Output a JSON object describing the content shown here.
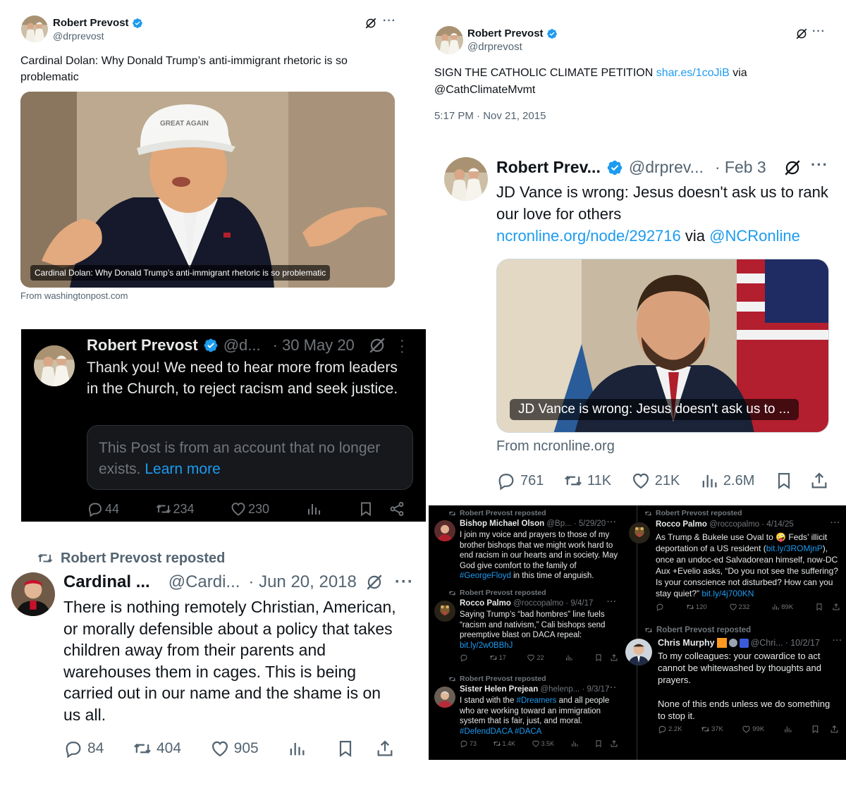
{
  "colors": {
    "link": "#1d9bf0",
    "verified": "#1d9bf0",
    "muted": "#536471",
    "dark_muted": "#71767b"
  },
  "icons": [
    "verified-badge-icon",
    "grok-icon",
    "more-icon",
    "reply-icon",
    "repost-icon",
    "like-icon",
    "views-icon",
    "bookmark-icon",
    "share-icon"
  ],
  "p1": {
    "name": "Robert Prevost",
    "handle": "@drprevost",
    "text": "Cardinal Dolan: Why Donald Trump’s anti-immigrant rhetoric is so problematic",
    "card_caption": "Cardinal Dolan: Why Donald Trump’s anti-immigrant rhetoric is so problematic",
    "card_source": "From washingtonpost.com",
    "hat_text": "GREAT AGAIN"
  },
  "p2": {
    "name": "Robert Prevost",
    "handle": "@drprevost",
    "text": "SIGN THE CATHOLIC CLIMATE PETITION ",
    "link": "shar.es/1coJiB",
    "text_tail": " via",
    "line2": "@CathClimateMvmt",
    "timestamp": "5:17 PM · Nov 21, 2015"
  },
  "p3": {
    "name": "Robert Prev...",
    "handle": "@drprev...",
    "date": "· Feb 3",
    "text": "JD Vance is wrong: Jesus doesn't ask us to rank our love for others",
    "link": "ncronline.org/node/292716",
    "via": " via ",
    "mention": "@NCRonline",
    "card_caption": "JD Vance is wrong: Jesus doesn't ask us to ...",
    "card_source": "From ncronline.org",
    "stats": {
      "replies": "761",
      "reposts": "11K",
      "likes": "21K",
      "views": "2.6M"
    }
  },
  "p4": {
    "name": "Robert Prevost",
    "handle": "@d...",
    "date": "· 30 May 20",
    "text": "Thank you! We need to hear more from leaders in the Church, to reject racism and seek justice.",
    "notice": "This Post is from an account that no longer exists. ",
    "notice_link": "Learn more",
    "stats": {
      "replies": "44",
      "reposts": "234",
      "likes": "230"
    }
  },
  "p5": {
    "repost_label": "Robert Prevost reposted",
    "name": "Cardinal ...",
    "handle": "@Cardi...",
    "date": "· Jun 20, 2018",
    "text": "There is nothing remotely Christian, American, or morally defensible about a policy that takes children away from their parents and warehouses them in cages. This is being carried out in our name and the shame is on us all.",
    "stats": {
      "replies": "84",
      "reposts": "404",
      "likes": "905"
    }
  },
  "g": {
    "olson": {
      "repost_label": "Robert Prevost reposted",
      "name": "Bishop Michael Olson",
      "handle": "@Bp...",
      "date": "· 5/29/20",
      "text": "I join my voice and prayers to those of my brother bishops that we might work hard to end racism in our hearts and in society. May God give comfort to the family of ",
      "hashtag": "#GeorgeFloyd",
      "tail": " in this time of anguish."
    },
    "palmo1": {
      "repost_label": "Robert Prevost reposted",
      "name": "Rocco Palmo",
      "handle": "@roccopalmo",
      "date": "· 9/4/17",
      "text": "Saying Trump’s “bad hombres” line fuels “racism and nativism,” Cali bishops send preemptive blast on DACA repeal: ",
      "link": "bit.ly/2w0BBhJ",
      "stats": {
        "reposts": "17",
        "likes": "22"
      }
    },
    "prejean": {
      "repost_label": "Robert Prevost reposted",
      "name": "Sister Helen Prejean",
      "handle": "@helenp...",
      "date": "· 9/3/17",
      "text1": "I stand with the ",
      "hashtag1": "#Dreamers",
      "text2": " and all people who are working toward an immigration system that is fair, just, and moral. ",
      "hashtag2": "#DefendDACA",
      "hashtag3": "#DACA",
      "stats": {
        "replies": "73",
        "reposts": "1.4K",
        "likes": "3.5K"
      }
    },
    "palmo2": {
      "repost_label": "Robert Prevost reposted",
      "name": "Rocco Palmo",
      "handle": "@roccopalmo",
      "date": "· 4/14/25",
      "text1": "As Trump & Bukele use Oval to ",
      "emoji": "🤪",
      "text2": " Feds’ illicit deportation of a US resident (",
      "link1": "bit.ly/3ROMjnP",
      "text3": "), once an undoc-ed Salvadorean himself, now-DC Aux +Evelio asks, “Do you not see the suffering? Is your conscience not disturbed? How can you stay quiet?” ",
      "link2": "bit.ly/4j700KN",
      "stats": {
        "reposts": "120",
        "likes": "232",
        "views": "89K"
      }
    },
    "murphy": {
      "repost_label": "Robert Prevost reposted",
      "name": "Chris Murphy",
      "handle": "@Chri...",
      "date": "· 10/2/17",
      "text": "To my colleagues: your cowardice to act cannot be whitewashed by thoughts and prayers.",
      "text2": "None of this ends unless we do something to stop it.",
      "stats": {
        "replies": "2.2K",
        "reposts": "37K",
        "likes": "99K"
      }
    }
  }
}
